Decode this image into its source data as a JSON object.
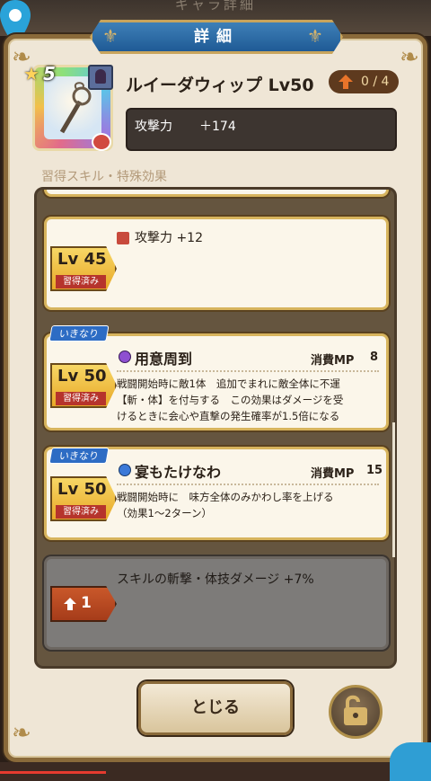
{
  "background": {
    "faded_title": "ギャラ詳細"
  },
  "header": {
    "title": "詳細"
  },
  "item": {
    "stars": "5",
    "name": "ルイーダウィップ Lv50",
    "limit_break": "0 / 4",
    "stat": {
      "label": "攻撃力",
      "value": "＋174"
    }
  },
  "section": {
    "label": "習得スキル・特殊効果"
  },
  "skills": [
    {
      "level": "Lv 45",
      "status": "習得済み",
      "name": "攻撃力 +12",
      "icon": "attack-icon"
    },
    {
      "tag": "いきなり",
      "level": "Lv 50",
      "status": "習得済み",
      "name": "用意周到",
      "mp_label": "消費MP",
      "mp": "8",
      "desc": "戦闘開始時に敵1体　追加でまれに敵全体に不運\n【斬・体】を付与する　この効果はダメージを受\nけるときに会心や直撃の発生確率が1.5倍になる",
      "icon": "purple-orb-icon"
    },
    {
      "tag": "いきなり",
      "level": "Lv 50",
      "status": "習得済み",
      "name": "宴もたけなわ",
      "mp_label": "消費MP",
      "mp": "15",
      "desc": "戦闘開始時に　味方全体のみかわし率を上げる\n（効果1～2ターン）",
      "icon": "blue-orb-icon"
    },
    {
      "level": "1",
      "name": "スキルの斬撃・体技ダメージ +7%",
      "locked": true
    }
  ],
  "buttons": {
    "close": "とじる"
  },
  "colors": {
    "accent_gold": "#d7b45d",
    "header_blue": "#2f6fad",
    "badge_red": "#b6342c"
  }
}
